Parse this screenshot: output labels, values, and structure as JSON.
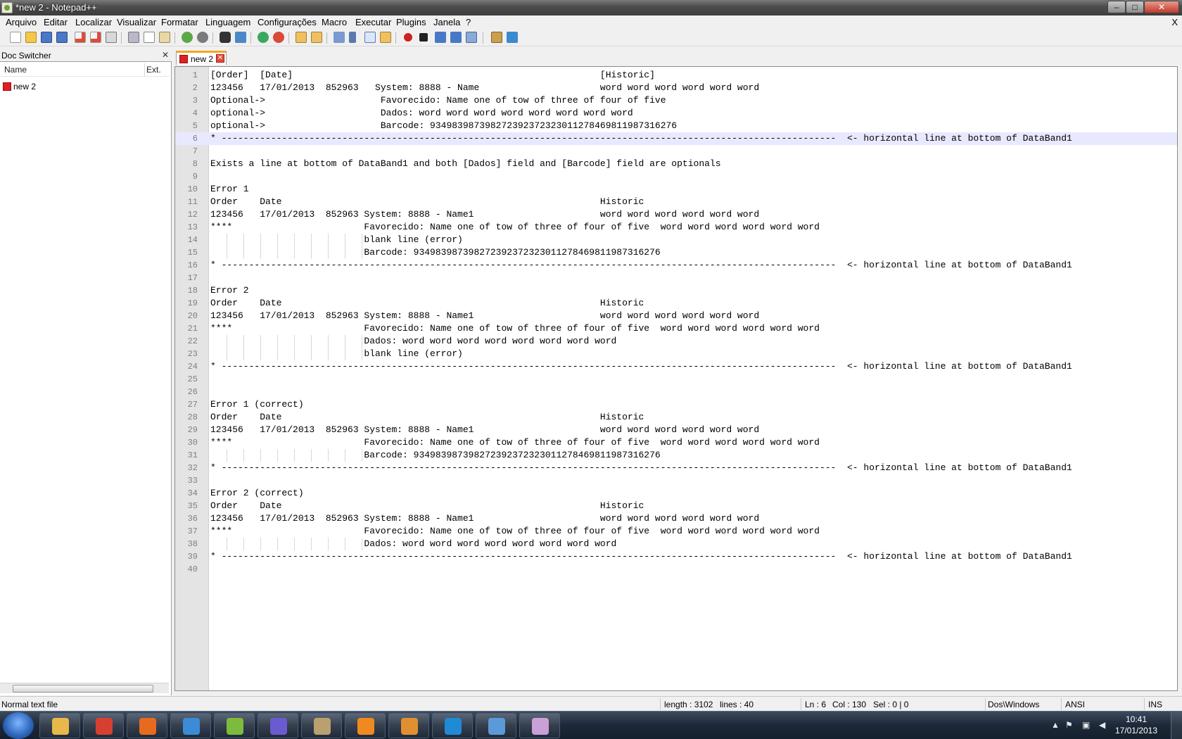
{
  "window": {
    "title": "*new  2 - Notepad++",
    "minimize_label": "–",
    "maximize_label": "□",
    "close_label": "✕"
  },
  "menu": {
    "items": [
      "Arquivo",
      "Editar",
      "Localizar",
      "Visualizar",
      "Formatar",
      "Linguagem",
      "Configurações",
      "Macro",
      "Executar",
      "Plugins",
      "Janela",
      "?"
    ],
    "close_label": "X"
  },
  "toolbar": {
    "icons": [
      "new-file-icon",
      "open-file-icon",
      "save-icon",
      "save-all-icon",
      "close-icon",
      "close-all-icon",
      "print-icon",
      "cut-icon",
      "copy-icon",
      "paste-icon",
      "undo-icon",
      "redo-icon",
      "find-icon",
      "replace-icon",
      "zoom-in-icon",
      "zoom-out-icon",
      "sync-vertical-icon",
      "sync-horizontal-icon",
      "word-wrap-icon",
      "show-all-characters-icon",
      "indent-guide-icon",
      "folder-as-workspace-icon",
      "record-macro-icon",
      "stop-macro-icon",
      "play-macro-icon",
      "run-macro-multiple-icon",
      "save-macro-icon",
      "launch-browser-icon",
      "spell-check-icon"
    ]
  },
  "doc_switcher": {
    "title": "Doc Switcher",
    "close_label": "✕",
    "col_name": "Name",
    "col_ext": "Ext.",
    "files": [
      {
        "name": "new  2"
      }
    ]
  },
  "tabs": [
    {
      "label": "new  2",
      "close_label": "✕"
    }
  ],
  "editor": {
    "current_line": 6,
    "lines": [
      "[Order]  [Date]                                                        [Historic]",
      "123456   17/01/2013  852963   System: 8888 - Name                      word word word word word word",
      "Optional->                     Favorecido: Name one of tow of three of four of five",
      "optional->                     Dados: word word word word word word word word",
      "optional->                     Barcode: 934983987398272392372323011278469811987316276",
      "* ----------------------------------------------------------------------------------------------------------------  <- horizontal line at bottom of DataBand1",
      "",
      "Exists a line at bottom of DataBand1 and both [Dados] field and [Barcode] field are optionals",
      "",
      "Error 1",
      "Order    Date                                                          Historic",
      "123456   17/01/2013  852963 System: 8888 - Name1                       word word word word word word",
      "****                        Favorecido: Name one of tow of three of four of five  word word word word word word",
      "                            blank line (error)",
      "                            Barcode: 934983987398272392372323011278469811987316276",
      "* ----------------------------------------------------------------------------------------------------------------  <- horizontal line at bottom of DataBand1",
      "",
      "Error 2",
      "Order    Date                                                          Historic",
      "123456   17/01/2013  852963 System: 8888 - Name1                       word word word word word word",
      "****                        Favorecido: Name one of tow of three of four of five  word word word word word word",
      "                            Dados: word word word word word word word word",
      "                            blank line (error)",
      "* ----------------------------------------------------------------------------------------------------------------  <- horizontal line at bottom of DataBand1",
      "",
      "",
      "Error 1 (correct)",
      "Order    Date                                                          Historic",
      "123456   17/01/2013  852963 System: 8888 - Name1                       word word word word word word",
      "****                        Favorecido: Name one of tow of three of four of five  word word word word word word",
      "                            Barcode: 934983987398272392372323011278469811987316276",
      "* ----------------------------------------------------------------------------------------------------------------  <- horizontal line at bottom of DataBand1",
      "",
      "Error 2 (correct)",
      "Order    Date                                                          Historic",
      "123456   17/01/2013  852963 System: 8888 - Name1                       word word word word word word",
      "****                        Favorecido: Name one of tow of three of four of five  word word word word word word",
      "                            Dados: word word word word word word word word",
      "* ----------------------------------------------------------------------------------------------------------------  <- horizontal line at bottom of DataBand1",
      ""
    ]
  },
  "status": {
    "file_type": "Normal text file",
    "length": "length : 3102",
    "lines": "lines : 40",
    "ln": "Ln : 6",
    "col": "Col : 130",
    "sel": "Sel : 0 | 0",
    "eol": "Dos\\Windows",
    "encoding": "ANSI",
    "mode": "INS"
  },
  "taskbar": {
    "apps": [
      {
        "name": "windows-explorer-icon",
        "color": "#e8b84a"
      },
      {
        "name": "chrome-icon",
        "color": "#d64032"
      },
      {
        "name": "firefox-icon",
        "color": "#e76a1f"
      },
      {
        "name": "internet-explorer-icon",
        "color": "#3b8bd6"
      },
      {
        "name": "notepad-plus-plus-icon",
        "color": "#7dbb3c"
      },
      {
        "name": "visual-studio-icon",
        "color": "#6b5bd1"
      },
      {
        "name": "tools-icon",
        "color": "#b8a070"
      },
      {
        "name": "media-icon",
        "color": "#f08a20"
      },
      {
        "name": "player-icon",
        "color": "#e09030"
      },
      {
        "name": "skype-icon",
        "color": "#1f8ad6"
      },
      {
        "name": "remote-desktop-icon",
        "color": "#5a9ad8"
      },
      {
        "name": "paint-icon",
        "color": "#c9a0d8"
      }
    ],
    "time": "10:41",
    "date": "17/01/2013"
  }
}
